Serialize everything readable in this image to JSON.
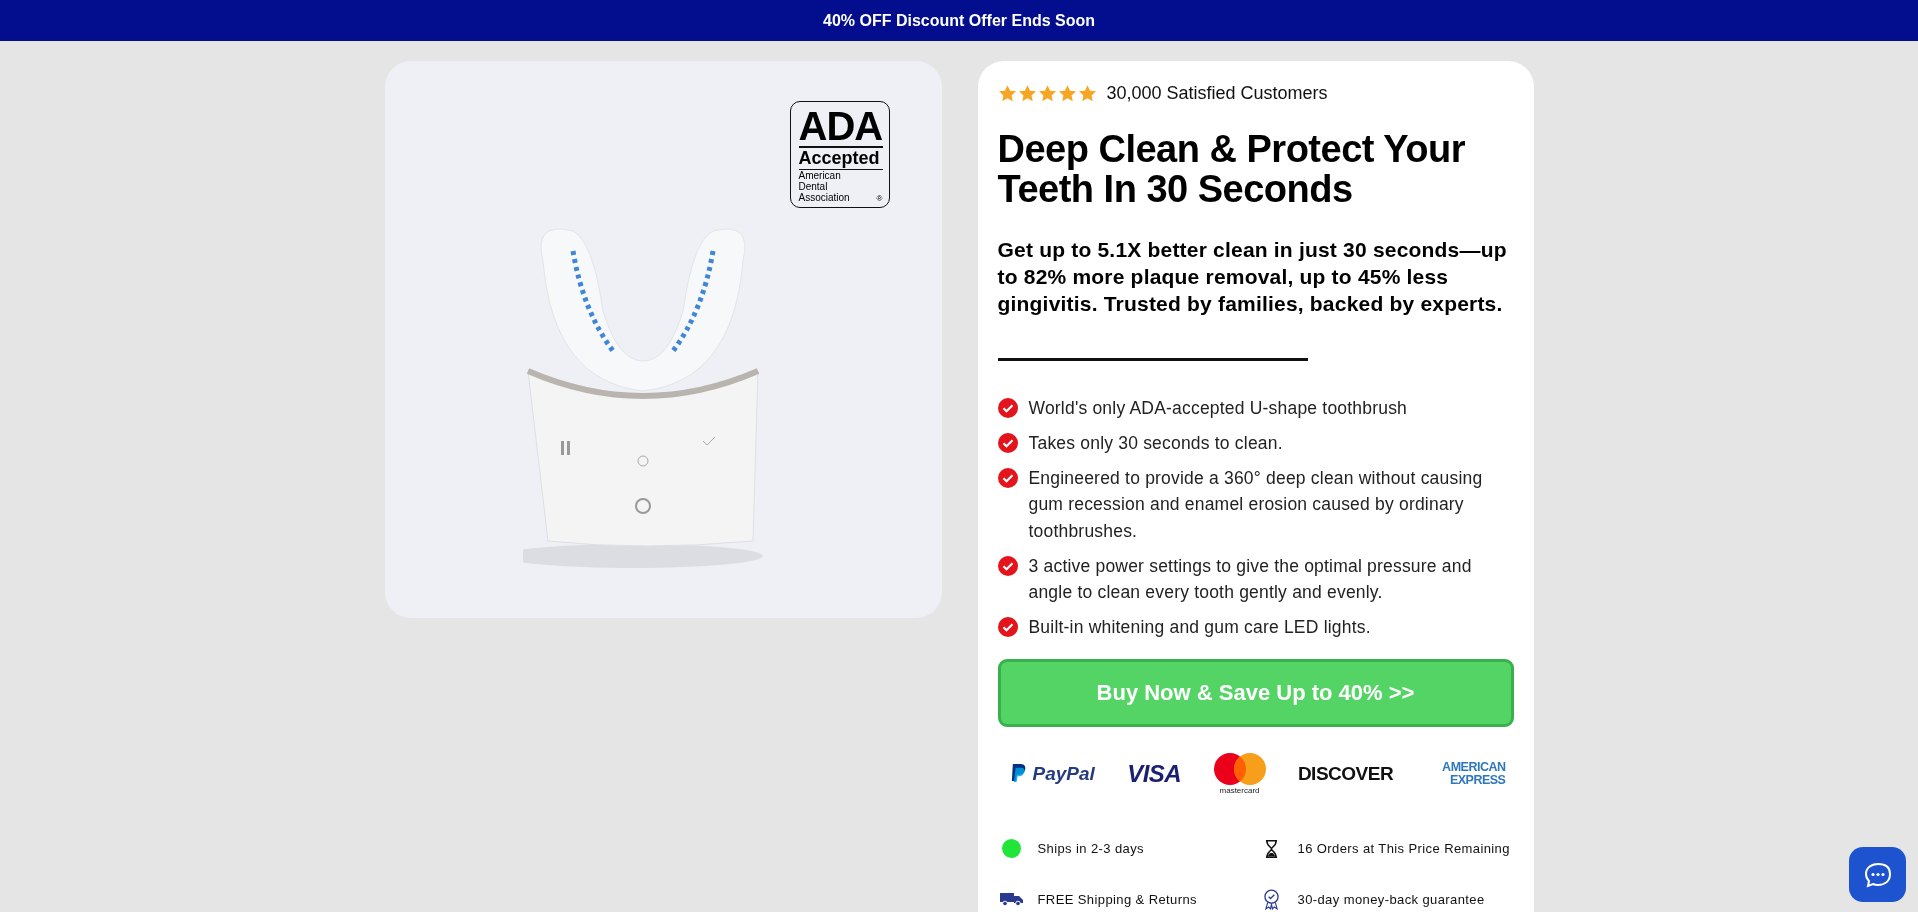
{
  "banner": {
    "text": "40% OFF Discount Offer Ends Soon"
  },
  "ada_badge": {
    "mark": "ADA",
    "status": "Accepted",
    "org": "American Dental Association",
    "registered": "®"
  },
  "rating": {
    "stars": 5,
    "label": "30,000 Satisfied Customers"
  },
  "headline": "Deep Clean & Protect Your Teeth In 30 Seconds",
  "subheadline": "Get up to 5.1X better clean in just 30 seconds—up to 82% more plaque removal, up to 45% less gingivitis. Trusted by families, backed by experts.",
  "benefits": [
    "World's only ADA-accepted U-shape toothbrush",
    "Takes only 30 seconds to clean.",
    "Engineered to provide a 360° deep clean without causing gum recession and enamel erosion caused by ordinary toothbrushes.",
    "3 active power settings to give the optimal pressure and angle to clean every tooth gently and evenly.",
    "Built-in whitening and gum care LED lights."
  ],
  "cta_button": "Buy Now & Save Up to 40% >>",
  "payment_methods": [
    {
      "kind": "paypal",
      "label": "PayPal"
    },
    {
      "kind": "visa",
      "label": "VISA"
    },
    {
      "kind": "mastercard",
      "label": "mastercard"
    },
    {
      "kind": "discover",
      "label": "DISCOVER"
    },
    {
      "kind": "amex",
      "label": "AMERICAN EXPRESS"
    }
  ],
  "features": [
    {
      "kind": "dot",
      "label": "Ships in 2-3 days"
    },
    {
      "kind": "hourglass",
      "label": "16 Orders at This Price Remaining"
    },
    {
      "kind": "truck",
      "label": "FREE Shipping & Returns"
    },
    {
      "kind": "award",
      "label": "30-day money-back guarantee"
    }
  ]
}
